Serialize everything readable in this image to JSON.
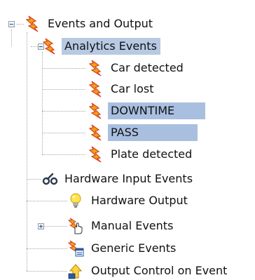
{
  "tree": {
    "root": {
      "label": "Events and Output",
      "icon": "lightning-bolt-icon",
      "expanded": true
    },
    "analytics": {
      "label": "Analytics Events",
      "icon": "lightning-bolt-icon",
      "expanded": true,
      "selected": true,
      "children": [
        {
          "label": "Car detected",
          "icon": "lightning-bolt-icon",
          "highlighted": false
        },
        {
          "label": "Car lost",
          "icon": "lightning-bolt-icon",
          "highlighted": false
        },
        {
          "label": "DOWNTIME",
          "icon": "lightning-bolt-icon",
          "highlighted": true
        },
        {
          "label": "PASS",
          "icon": "lightning-bolt-icon",
          "highlighted": true
        },
        {
          "label": "Plate detected",
          "icon": "lightning-bolt-icon",
          "highlighted": false
        }
      ]
    },
    "siblings": [
      {
        "label": "Hardware Input Events",
        "icon": "input-switch-icon",
        "expandable": false
      },
      {
        "label": "Hardware Output",
        "icon": "light-bulb-icon",
        "expandable": false
      },
      {
        "label": "Manual Events",
        "icon": "hand-pointer-icon",
        "expandable": true,
        "expanded": false
      },
      {
        "label": "Generic Events",
        "icon": "generic-event-icon",
        "expandable": false
      },
      {
        "label": "Output Control on Event",
        "icon": "output-control-icon",
        "expandable": false
      }
    ]
  },
  "colors": {
    "selection": "#b8c9e3",
    "highlight": "#a9bfe0",
    "bolt_orange": "#f0a01e",
    "bolt_red": "#d8401a",
    "tree_line": "#a8a8a8"
  }
}
